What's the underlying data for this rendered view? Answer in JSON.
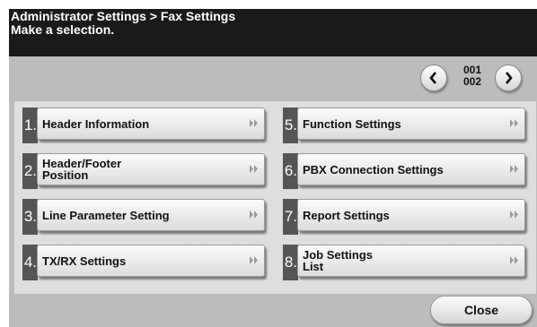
{
  "header": {
    "breadcrumb": "Administrator Settings > Fax Settings",
    "instruction": "Make a selection."
  },
  "pager": {
    "current": "001",
    "total": "002",
    "prev_icon": "chevron-left-icon",
    "next_icon": "chevron-right-icon"
  },
  "menu": {
    "items": [
      {
        "number": "1.",
        "label": "Header Information"
      },
      {
        "number": "2.",
        "label": "Header/Footer\nPosition"
      },
      {
        "number": "3.",
        "label": "Line Parameter Setting"
      },
      {
        "number": "4.",
        "label": "TX/RX Settings"
      },
      {
        "number": "5.",
        "label": "Function Settings"
      },
      {
        "number": "6.",
        "label": "PBX Connection Settings"
      },
      {
        "number": "7.",
        "label": "Report Settings"
      },
      {
        "number": "8.",
        "label": "Job Settings\nList"
      }
    ],
    "arrow_icon": "double-chevron-right-icon"
  },
  "footer": {
    "close_label": "Close"
  },
  "colors": {
    "header_bg": "#1a1a1a",
    "screen_bg": "#bcbcbc",
    "panel_bg": "#dedede",
    "number_tab": "#555555"
  }
}
